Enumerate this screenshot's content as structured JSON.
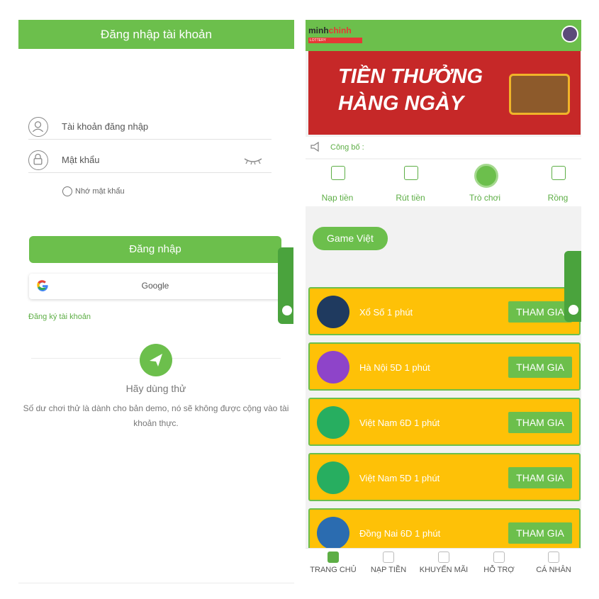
{
  "login": {
    "header_title": "Đăng nhập tài khoản",
    "account_placeholder": "Tài khoản đăng nhập",
    "password_placeholder": "Mật khẩu",
    "remember_label": "Nhớ mật khẩu",
    "login_button": "Đăng nhập",
    "google_label": "Google",
    "register_link": "Đăng ký tài khoản",
    "try_title": "Hãy dùng thử",
    "try_description": "Số dư chơi thử là dành cho bản demo, nó sẽ không được cộng vào tài khoản thực."
  },
  "home": {
    "logo_text_1": "minh",
    "logo_text_2": "chinh",
    "logo_sub": "LOTTERY",
    "banner_line1": "TIỀN THƯỞNG",
    "banner_line2": "HÀNG NGÀY",
    "announcement_label": "Công bố :",
    "nav_items": [
      {
        "label": "Nạp tiền",
        "icon": "deposit-icon"
      },
      {
        "label": "Rút tiền",
        "icon": "withdraw-icon"
      },
      {
        "label": "Trò chơi",
        "icon": "game-icon"
      },
      {
        "label": "Rồng",
        "icon": "dragon-icon"
      }
    ],
    "category_tab": "Game Việt",
    "join_label": "THAM GIA",
    "games": [
      {
        "name": "Xổ Số 1 phút"
      },
      {
        "name": "Hà Nội 5D 1 phút"
      },
      {
        "name": "Việt Nam 6D 1 phút"
      },
      {
        "name": "Việt Nam 5D 1 phút"
      },
      {
        "name": "Đồng Nai 6D 1 phút"
      }
    ],
    "bottom_nav": [
      {
        "label": "TRANG CHỦ",
        "icon": "home-icon"
      },
      {
        "label": "NẠP TIỀN",
        "icon": "deposit-icon"
      },
      {
        "label": "KHUYẾN MÃI",
        "icon": "gift-icon"
      },
      {
        "label": "HỖ TRỢ",
        "icon": "support-icon"
      },
      {
        "label": "CÁ NHÂN",
        "icon": "profile-icon"
      }
    ]
  },
  "colors": {
    "green": "#6cbf4c",
    "yellow": "#fec107",
    "red": "#c62828"
  }
}
